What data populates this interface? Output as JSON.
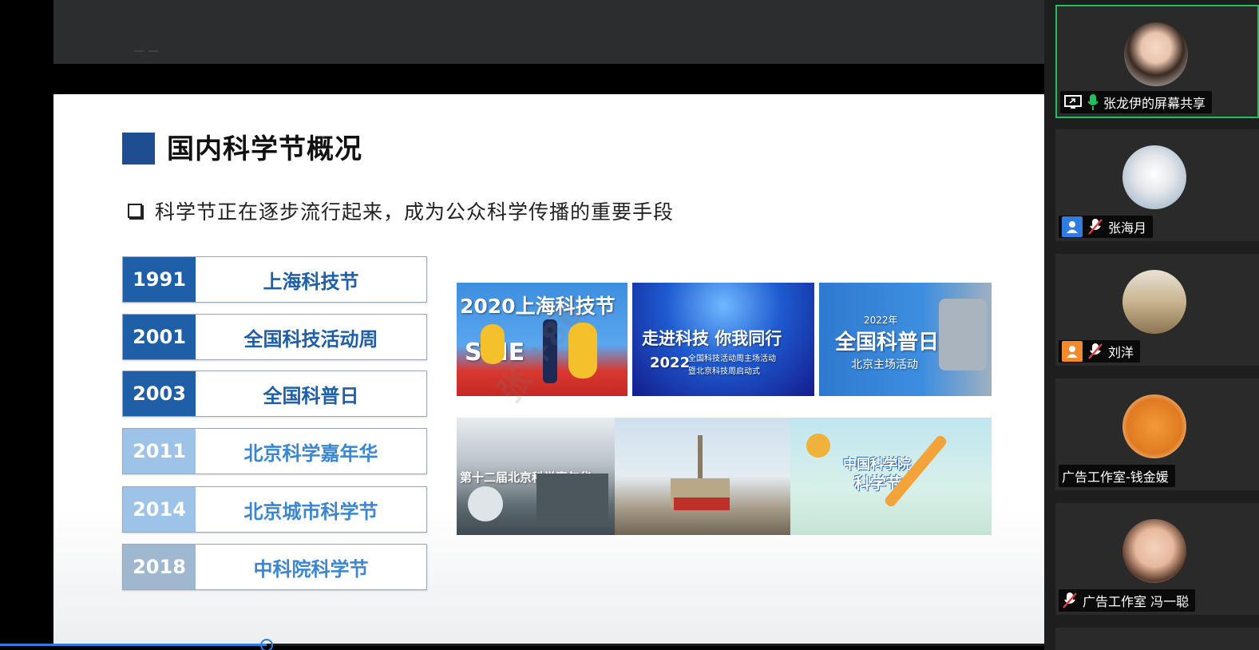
{
  "slide": {
    "title": "国内科学节概况",
    "bullet": "科学节正在逐步流行起来，成为公众科学传播的重要手段",
    "timeline": [
      {
        "year": "1991",
        "label": "上海科技节",
        "year_bg": "#1e5fa8",
        "label_color": "#1e5fa8"
      },
      {
        "year": "2001",
        "label": "全国科技活动周",
        "year_bg": "#1e5fa8",
        "label_color": "#1e5fa8"
      },
      {
        "year": "2003",
        "label": "全国科普日",
        "year_bg": "#1e5fa8",
        "label_color": "#1e5fa8"
      },
      {
        "year": "2011",
        "label": "北京科学嘉年华",
        "year_bg": "#9ec3e8",
        "label_color": "#3a86d1"
      },
      {
        "year": "2014",
        "label": "北京城市科学节",
        "year_bg": "#9ec3e8",
        "label_color": "#3a86d1"
      },
      {
        "year": "2018",
        "label": "中科院科学节",
        "year_bg": "#9fb7cf",
        "label_color": "#3a86d1"
      }
    ],
    "photos": {
      "p1_caption": "2020上海科技节",
      "p1_banner": "SCIE",
      "p2_caption": "走进科技 你我同行",
      "p2_year": "2022",
      "p2_sub1": "全国科技活动周主场活动",
      "p2_sub2": "暨北京科技周启动式",
      "p3_year": "2022年",
      "p3_caption": "全国科普日",
      "p3_sub": "北京主场活动",
      "p4_caption": "第十二届北京科学嘉年华",
      "p6_caption": "中国科学院",
      "p6_caption2": "科学节"
    },
    "watermark": "张 +86"
  },
  "participants": [
    {
      "name": "张龙伊的屏幕共享",
      "active": true,
      "icon": "screen-share",
      "mic": "on"
    },
    {
      "name": "张海月",
      "active": false,
      "icon": "person-blue",
      "mic": "muted"
    },
    {
      "name": "刘洋",
      "active": false,
      "icon": "person-orange",
      "mic": "muted"
    },
    {
      "name": "广告工作室-钱金媛",
      "active": false,
      "icon": "none",
      "mic": "none"
    },
    {
      "name": "广告工作室 冯一聪",
      "active": false,
      "icon": "none",
      "mic": "muted"
    }
  ],
  "colors": {
    "accent_blue": "#1f4d92",
    "active_border": "#22c15e",
    "progress": "#2f7de1"
  },
  "playback_progress_fraction": 0.255
}
